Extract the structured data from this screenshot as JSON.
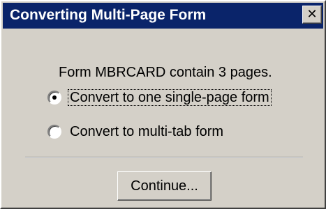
{
  "window": {
    "title": "Converting Multi-Page Form",
    "close_glyph": "✕",
    "close_icon": "close-icon"
  },
  "message": "Form MBRCARD contain 3 pages.",
  "options": [
    {
      "label": "Convert to one single-page form",
      "selected": true,
      "focused": true
    },
    {
      "label": "Convert to multi-tab form",
      "selected": false,
      "focused": false
    }
  ],
  "buttons": {
    "continue_label": "Continue..."
  },
  "colors": {
    "title_bar": "#0a246a",
    "dialog_face": "#d4d0c8"
  }
}
